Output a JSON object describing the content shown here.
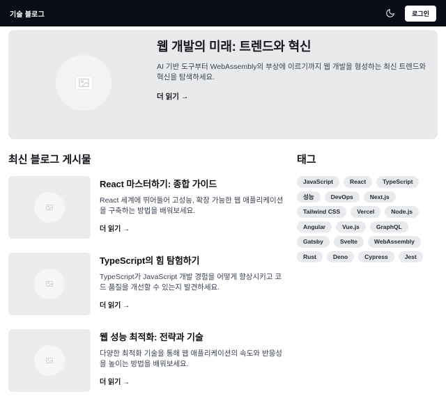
{
  "header": {
    "site_title": "기술 블로그",
    "login_label": "로그인",
    "theme_icon": "moon-icon",
    "bg_color": "#0a0e17"
  },
  "hero": {
    "title": "웹 개발의 미래: 트렌드와 혁신",
    "description": "AI 기반 도구부터 WebAssembly의 부상에 이르기까지 웹 개발을 형성하는 최신 트렌드와 혁신을 탐색하세요.",
    "read_more_label": "더 읽기 →",
    "bg_color": "#e9eaec",
    "placeholder_icon": "image-placeholder-icon"
  },
  "posts": {
    "heading": "최신 블로그 게시물",
    "items": [
      {
        "title": "React 마스터하기: 종합 가이드",
        "description": "React 세계에 뛰어들어 고성능, 확장 가능한 웹 애플리케이션을 구축하는 방법을 배워보세요.",
        "read_more_label": "더 읽기 →"
      },
      {
        "title": "TypeScript의 힘 탐험하기",
        "description": "TypeScript가 JavaScript 개발 경험을 어떻게 향상시키고 코드 품질을 개선할 수 있는지 발견하세요.",
        "read_more_label": "더 읽기 →"
      },
      {
        "title": "웹 성능 최적화: 전략과 기술",
        "description": "다양한 최적화 기술을 통해 웹 애플리케이션의 속도와 반응성을 높이는 방법을 배워보세요.",
        "read_more_label": "더 읽기 →"
      }
    ]
  },
  "tags": {
    "heading": "태그",
    "items": [
      "JavaScript",
      "React",
      "TypeScript",
      "성능",
      "DevOps",
      "Next.js",
      "Tailwind CSS",
      "Vercel",
      "Node.js",
      "Angular",
      "Vue.js",
      "GraphQL",
      "Gatsby",
      "Svelte",
      "WebAssembly",
      "Rust",
      "Deno",
      "Cypress",
      "Jest"
    ],
    "pill_bg": "#e8eaed"
  }
}
